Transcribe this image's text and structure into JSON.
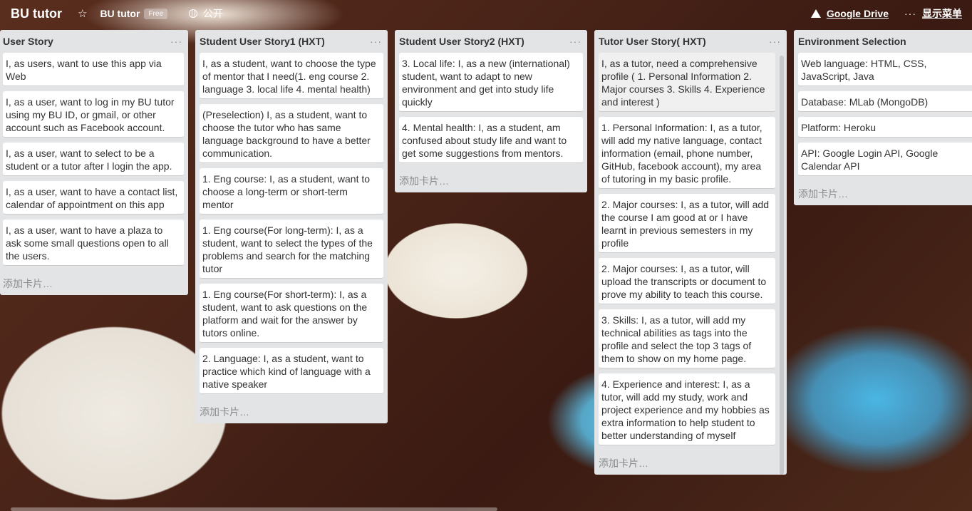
{
  "header": {
    "logo": "BU tutor",
    "board_name": "BU tutor",
    "badge": "Free",
    "visibility": "公开",
    "drive": "Google Drive",
    "menu": "显示菜单",
    "star_icon": "star-icon",
    "globe_icon": "globe-icon",
    "drive_icon": "google-drive-icon"
  },
  "add_card_label": "添加卡片…",
  "lists": [
    {
      "title": "User Story",
      "cards": [
        "I, as users, want to use this app via Web",
        "I, as a user, want to log in my BU tutor using my BU ID, or gmail, or other account such as Facebook account.",
        "I, as a user, want to select to be a student or a tutor after I login the app.",
        "I, as a user, want to have a contact list, calendar of appointment on this app",
        "I, as a user, want to have a plaza to ask some small questions open to all the users."
      ]
    },
    {
      "title": "Student User Story1 (HXT)",
      "cards": [
        "I, as a student, want to choose the type of mentor that I need(1. eng course 2. language 3. local life 4. mental health)",
        "(Preselection) I, as a student, want to choose the tutor who has same language background to have a better communication.",
        "1. Eng course: I, as a student, want to choose a long-term or short-term mentor",
        "1. Eng course(For long-term): I, as a student, want to select the types of the problems and search for the matching tutor",
        "1. Eng course(For short-term): I, as a student, want to ask questions on the platform and wait for the answer by tutors online.",
        "2. Language: I, as a student, want to practice which kind of language with a native speaker"
      ]
    },
    {
      "title": "Student User Story2 (HXT)",
      "cards": [
        "3. Local life: I, as a new (international) student, want to adapt to new environment and get into study life quickly",
        "4. Mental health: I, as a student, am confused about study life and want to get some suggestions from mentors."
      ]
    },
    {
      "title": "Tutor User Story( HXT)",
      "cards": [
        "I, as a tutor, need a comprehensive profile ( 1. Personal Information 2. Major courses 3. Skills 4. Experience and interest )",
        "1. Personal Information: I, as a tutor, will add my native language, contact information (email, phone number, GitHub, facebook account), my area of tutoring in my basic profile.",
        "2. Major courses: I, as a tutor, will add the course I am good at or I have learnt in previous semesters in my profile",
        "2. Major courses: I, as a tutor, will upload the transcripts or document to prove my ability to teach this course.",
        "3. Skills: I, as a tutor, will add my technical abilities as tags into the profile and select the top 3 tags of them to show on my home page.",
        "4. Experience and interest: I, as a tutor, will add my study, work and project experience and my hobbies as extra information to help student to better understanding of myself"
      ]
    },
    {
      "title": "Environment Selection",
      "cards": [
        "Web language: HTML, CSS, JavaScript, Java",
        "Database: MLab (MongoDB)",
        "Platform: Heroku",
        "API: Google Login API, Google Calendar API"
      ]
    }
  ]
}
